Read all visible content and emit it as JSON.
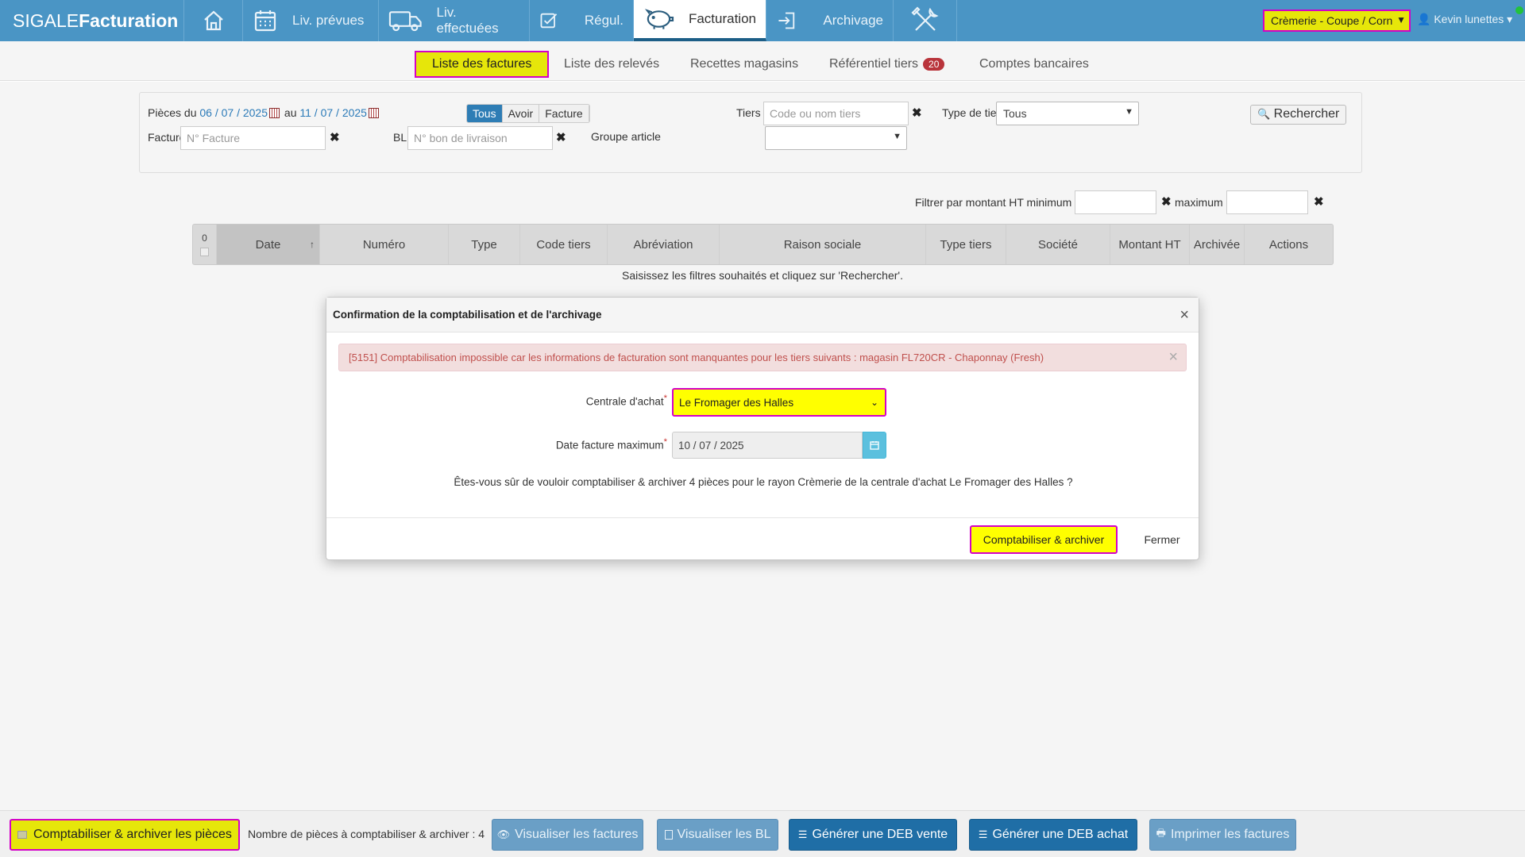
{
  "brand": {
    "light": "SIGALE",
    "bold": "Facturation"
  },
  "nav": [
    {
      "label": ""
    },
    {
      "label": "Liv. prévues"
    },
    {
      "label": "Liv. effectuées"
    },
    {
      "label": "Régul."
    },
    {
      "label": "Facturation"
    },
    {
      "label": "Archivage"
    },
    {
      "label": ""
    }
  ],
  "rayon_select": "Crèmerie - Coupe / Corn",
  "user": "Kevin lunettes",
  "subtabs": {
    "liste_factures": "Liste des factures",
    "liste_releves": "Liste des relevés",
    "recettes": "Recettes magasins",
    "referentiel": "Référentiel tiers",
    "referentiel_count": "20",
    "comptes": "Comptes bancaires"
  },
  "filters": {
    "pieces_du": "Pièces du",
    "date_from": "06 / 07 / 2025",
    "au": "au",
    "date_to": "11 / 07 / 2025",
    "type_buttons": [
      "Tous",
      "Avoir",
      "Facture"
    ],
    "tiers_label": "Tiers",
    "tiers_placeholder": "Code ou nom tiers",
    "type_tiers_label": "Type de tiers",
    "type_tiers_value": "Tous",
    "search_button": "Rechercher",
    "facture_label": "Facture",
    "facture_placeholder": "N° Facture",
    "bl_label": "BL",
    "bl_placeholder": "N° bon de livraison",
    "groupe_label": "Groupe article",
    "groupe_value": "",
    "montant_label": "Filtrer par montant HT minimum",
    "maximum_label": "maximum",
    "clear": "✖"
  },
  "table": {
    "count": "0",
    "columns": [
      "Date",
      "Numéro",
      "Type",
      "Code tiers",
      "Abréviation",
      "Raison sociale",
      "Type tiers",
      "Société",
      "Montant HT",
      "Archivée",
      "Actions"
    ],
    "sort_icon": "↑",
    "empty_message": "Saisissez les filtres souhaités et cliquez sur 'Rechercher'."
  },
  "modal": {
    "title": "Confirmation de la comptabilisation et de l'archivage",
    "close": "×",
    "alert": "[5151] Comptabilisation impossible car les informations de facturation sont manquantes pour les tiers suivants : magasin FL720CR - Chaponnay (Fresh)",
    "alert_close": "×",
    "centrale_label": "Centrale d'achat",
    "centrale_value": "Le Fromager des Halles",
    "date_label": "Date facture maximum",
    "date_value": "10 / 07 / 2025",
    "required": "*",
    "confirm_text": "Êtes-vous sûr de vouloir comptabiliser & archiver 4 pièces pour le rayon Crèmerie de la centrale d'achat Le Fromager des Halles ?",
    "confirm_button": "Comptabiliser & archiver",
    "close_button": "Fermer"
  },
  "bottom": {
    "main_button": "Comptabiliser & archiver les pièces",
    "count_text": "Nombre de pièces à comptabiliser & archiver : 4",
    "visualiser_factures": "Visualiser les factures",
    "visualiser_bl": "Visualiser les BL",
    "deb_vente": "Générer une DEB vente",
    "deb_achat": "Générer une DEB achat",
    "imprimer": "Imprimer les factures"
  },
  "colors": {
    "navbar": "#4a95c5",
    "highlight": "#e6e60a",
    "highlight_border": "#d400c8",
    "dark_button": "#1f6ea6",
    "alert_text": "#c0504d"
  }
}
